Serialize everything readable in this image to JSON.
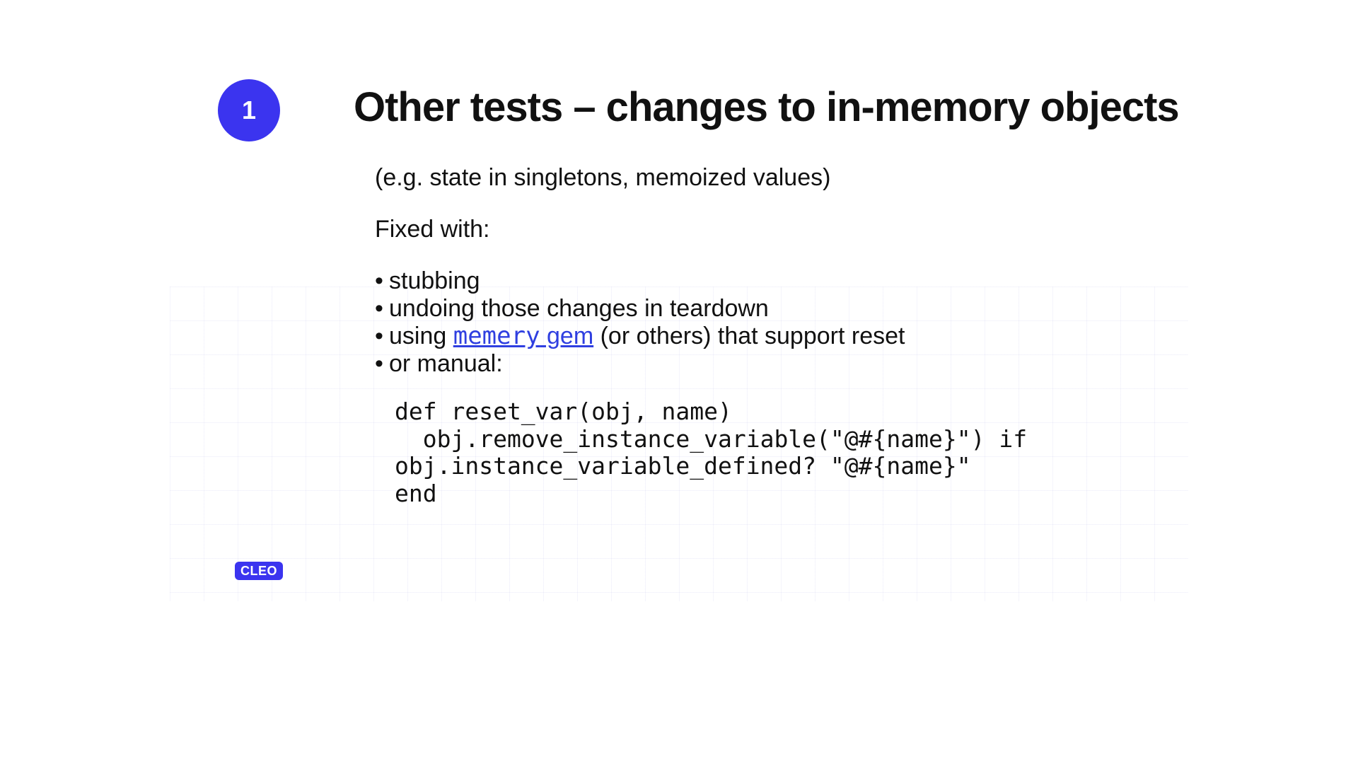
{
  "badge_number": "1",
  "title": "Other tests – changes to in-memory objects",
  "subtitle": "(e.g. state in singletons, memoized values)",
  "fixed_with_label": "Fixed with:",
  "bullets": {
    "b1": "stubbing",
    "b2": "undoing those changes in teardown",
    "b3_prefix": "using ",
    "b3_link_code": "memery",
    "b3_link_rest": " gem",
    "b3_suffix": " (or others) that support reset",
    "b4": "or manual:"
  },
  "code": "def reset_var(obj, name)\n  obj.remove_instance_variable(\"@#{name}\") if\nobj.instance_variable_defined? \"@#{name}\"\nend",
  "logo_text": "CLEO",
  "colors": {
    "accent": "#3b34ef",
    "link": "#2f3fe0"
  }
}
